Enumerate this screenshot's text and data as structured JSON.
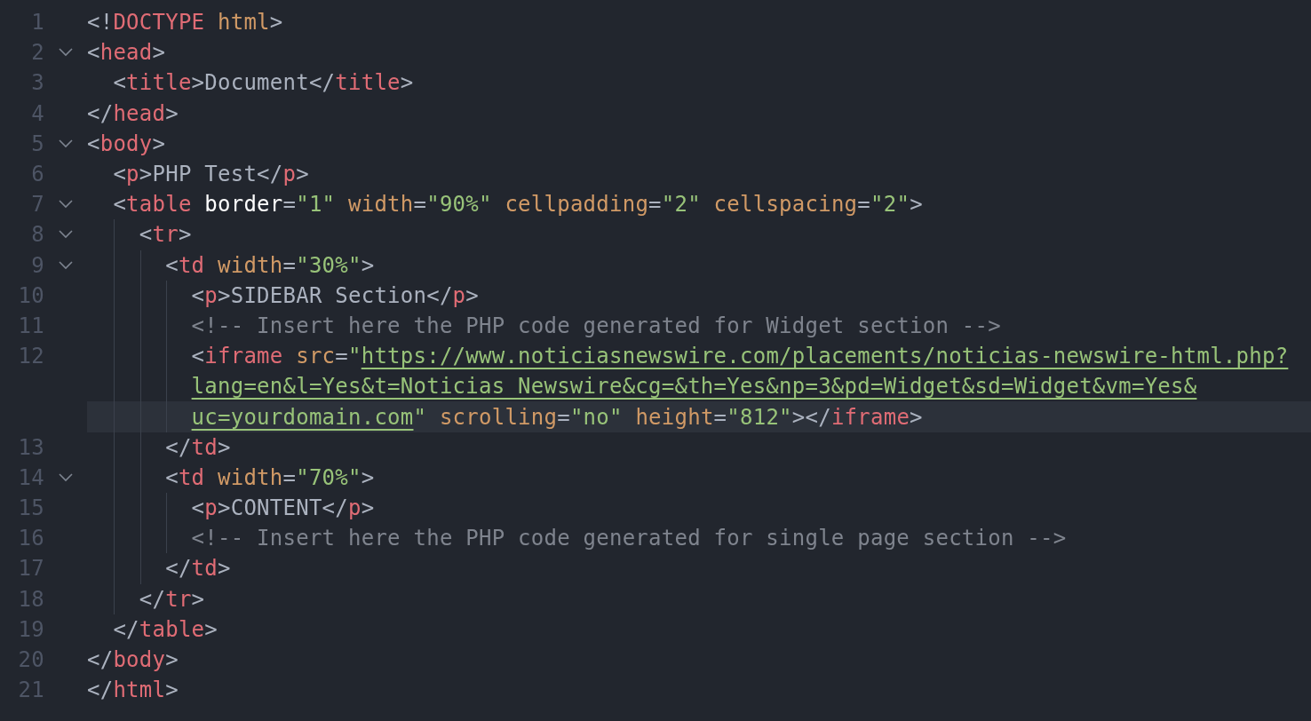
{
  "editor": {
    "lines": [
      {
        "number": "1",
        "rows": [
          {
            "highlighted": false,
            "tokens": [
              {
                "kind": "punct",
                "text": "<!"
              },
              {
                "kind": "tag",
                "text": "DOCTYPE"
              },
              {
                "kind": "attr",
                "text": " html"
              },
              {
                "kind": "punct",
                "text": ">"
              }
            ]
          }
        ]
      },
      {
        "number": "2",
        "expanded": true,
        "rows": [
          {
            "highlighted": false,
            "tokens": [
              {
                "kind": "punct",
                "text": "<"
              },
              {
                "kind": "tag",
                "text": "head"
              },
              {
                "kind": "punct",
                "text": ">"
              }
            ]
          }
        ],
        "children": [
          {
            "number": "3",
            "rows": [
              {
                "highlighted": false,
                "tokens": [
                  {
                    "kind": "punct",
                    "text": "<"
                  },
                  {
                    "kind": "tag",
                    "text": "title"
                  },
                  {
                    "kind": "punct",
                    "text": ">"
                  },
                  {
                    "kind": "text",
                    "text": "Document"
                  },
                  {
                    "kind": "punct",
                    "text": "</"
                  },
                  {
                    "kind": "tag",
                    "text": "title"
                  },
                  {
                    "kind": "punct",
                    "text": ">"
                  }
                ]
              }
            ]
          }
        ]
      },
      {
        "number": "4",
        "rows": [
          {
            "highlighted": false,
            "tokens": [
              {
                "kind": "punct",
                "text": "</"
              },
              {
                "kind": "tag",
                "text": "head"
              },
              {
                "kind": "punct",
                "text": ">"
              }
            ]
          }
        ]
      },
      {
        "number": "5",
        "expanded": true,
        "rows": [
          {
            "highlighted": false,
            "tokens": [
              {
                "kind": "punct",
                "text": "<"
              },
              {
                "kind": "tag",
                "text": "body"
              },
              {
                "kind": "punct",
                "text": ">"
              }
            ]
          }
        ],
        "children": [
          {
            "number": "6",
            "rows": [
              {
                "highlighted": false,
                "tokens": [
                  {
                    "kind": "punct",
                    "text": "<"
                  },
                  {
                    "kind": "tag",
                    "text": "p"
                  },
                  {
                    "kind": "punct",
                    "text": ">"
                  },
                  {
                    "kind": "text",
                    "text": "PHP Test"
                  },
                  {
                    "kind": "punct",
                    "text": "</"
                  },
                  {
                    "kind": "tag",
                    "text": "p"
                  },
                  {
                    "kind": "punct",
                    "text": ">"
                  }
                ]
              }
            ]
          },
          {
            "number": "7",
            "expanded": true,
            "rows": [
              {
                "highlighted": false,
                "tokens": [
                  {
                    "kind": "punct",
                    "text": "<"
                  },
                  {
                    "kind": "tag",
                    "text": "table"
                  },
                  {
                    "kind": "attr-strong",
                    "text": " border"
                  },
                  {
                    "kind": "punct",
                    "text": "="
                  },
                  {
                    "kind": "string",
                    "text": "\"1\""
                  },
                  {
                    "kind": "attr",
                    "text": " width"
                  },
                  {
                    "kind": "punct",
                    "text": "="
                  },
                  {
                    "kind": "string",
                    "text": "\"90%\""
                  },
                  {
                    "kind": "attr",
                    "text": " cellpadding"
                  },
                  {
                    "kind": "punct",
                    "text": "="
                  },
                  {
                    "kind": "string",
                    "text": "\"2\""
                  },
                  {
                    "kind": "attr",
                    "text": " cellspacing"
                  },
                  {
                    "kind": "punct",
                    "text": "="
                  },
                  {
                    "kind": "string",
                    "text": "\"2\""
                  },
                  {
                    "kind": "punct",
                    "text": ">"
                  }
                ]
              }
            ],
            "children": [
              {
                "number": "8",
                "expanded": true,
                "rows": [
                  {
                    "highlighted": false,
                    "tokens": [
                      {
                        "kind": "punct",
                        "text": "<"
                      },
                      {
                        "kind": "tag",
                        "text": "tr"
                      },
                      {
                        "kind": "punct",
                        "text": ">"
                      }
                    ]
                  }
                ],
                "children": [
                  {
                    "number": "9",
                    "expanded": true,
                    "rows": [
                      {
                        "highlighted": false,
                        "tokens": [
                          {
                            "kind": "punct",
                            "text": "<"
                          },
                          {
                            "kind": "tag",
                            "text": "td"
                          },
                          {
                            "kind": "attr",
                            "text": " width"
                          },
                          {
                            "kind": "punct",
                            "text": "="
                          },
                          {
                            "kind": "string",
                            "text": "\"30%\""
                          },
                          {
                            "kind": "punct",
                            "text": ">"
                          }
                        ]
                      }
                    ],
                    "children": [
                      {
                        "number": "10",
                        "rows": [
                          {
                            "highlighted": false,
                            "tokens": [
                              {
                                "kind": "punct",
                                "text": "<"
                              },
                              {
                                "kind": "tag",
                                "text": "p"
                              },
                              {
                                "kind": "punct",
                                "text": ">"
                              },
                              {
                                "kind": "text",
                                "text": "SIDEBAR Section"
                              },
                              {
                                "kind": "punct",
                                "text": "</"
                              },
                              {
                                "kind": "tag",
                                "text": "p"
                              },
                              {
                                "kind": "punct",
                                "text": ">"
                              }
                            ]
                          }
                        ]
                      },
                      {
                        "number": "11",
                        "rows": [
                          {
                            "highlighted": false,
                            "tokens": [
                              {
                                "kind": "comment",
                                "text": "<!-- Insert here the PHP code generated for Widget section -->"
                              }
                            ]
                          }
                        ]
                      },
                      {
                        "number": "12",
                        "rows": [
                          {
                            "highlighted": false,
                            "tokens": [
                              {
                                "kind": "punct",
                                "text": "<"
                              },
                              {
                                "kind": "tag",
                                "text": "iframe"
                              },
                              {
                                "kind": "attr",
                                "text": " src"
                              },
                              {
                                "kind": "punct",
                                "text": "="
                              },
                              {
                                "kind": "string",
                                "text": "\""
                              },
                              {
                                "kind": "link",
                                "text": "https://www.noticiasnewswire.com/placements/noticias-newswire-html.php?"
                              }
                            ]
                          },
                          {
                            "highlighted": false,
                            "tokens": [
                              {
                                "kind": "link",
                                "text": "lang=en&l=Yes&t=Noticias Newswire&cg=&th=Yes&np=3&pd=Widget&sd=Widget&vm=Yes&"
                              }
                            ]
                          },
                          {
                            "highlighted": true,
                            "tokens": [
                              {
                                "kind": "link",
                                "text": "uc=yourdomain.com"
                              },
                              {
                                "kind": "string",
                                "text": "\""
                              },
                              {
                                "kind": "attr",
                                "text": " scrolling"
                              },
                              {
                                "kind": "punct",
                                "text": "="
                              },
                              {
                                "kind": "string",
                                "text": "\"no\""
                              },
                              {
                                "kind": "attr",
                                "text": " height"
                              },
                              {
                                "kind": "punct",
                                "text": "="
                              },
                              {
                                "kind": "string",
                                "text": "\"812\""
                              },
                              {
                                "kind": "punct",
                                "text": "></"
                              },
                              {
                                "kind": "tag",
                                "text": "iframe"
                              },
                              {
                                "kind": "punct",
                                "text": ">"
                              }
                            ]
                          }
                        ]
                      }
                    ]
                  },
                  {
                    "number": "13",
                    "rows": [
                      {
                        "highlighted": false,
                        "tokens": [
                          {
                            "kind": "punct",
                            "text": "</"
                          },
                          {
                            "kind": "tag",
                            "text": "td"
                          },
                          {
                            "kind": "punct",
                            "text": ">"
                          }
                        ]
                      }
                    ]
                  },
                  {
                    "number": "14",
                    "expanded": true,
                    "rows": [
                      {
                        "highlighted": false,
                        "tokens": [
                          {
                            "kind": "punct",
                            "text": "<"
                          },
                          {
                            "kind": "tag",
                            "text": "td"
                          },
                          {
                            "kind": "attr",
                            "text": " width"
                          },
                          {
                            "kind": "punct",
                            "text": "="
                          },
                          {
                            "kind": "string",
                            "text": "\"70%\""
                          },
                          {
                            "kind": "punct",
                            "text": ">"
                          }
                        ]
                      }
                    ],
                    "children": [
                      {
                        "number": "15",
                        "rows": [
                          {
                            "highlighted": false,
                            "tokens": [
                              {
                                "kind": "punct",
                                "text": "<"
                              },
                              {
                                "kind": "tag",
                                "text": "p"
                              },
                              {
                                "kind": "punct",
                                "text": ">"
                              },
                              {
                                "kind": "text",
                                "text": "CONTENT"
                              },
                              {
                                "kind": "punct",
                                "text": "</"
                              },
                              {
                                "kind": "tag",
                                "text": "p"
                              },
                              {
                                "kind": "punct",
                                "text": ">"
                              }
                            ]
                          }
                        ]
                      },
                      {
                        "number": "16",
                        "rows": [
                          {
                            "highlighted": false,
                            "tokens": [
                              {
                                "kind": "comment",
                                "text": "<!-- Insert here the PHP code generated for single page section -->"
                              }
                            ]
                          }
                        ]
                      }
                    ]
                  },
                  {
                    "number": "17",
                    "rows": [
                      {
                        "highlighted": false,
                        "tokens": [
                          {
                            "kind": "punct",
                            "text": "</"
                          },
                          {
                            "kind": "tag",
                            "text": "td"
                          },
                          {
                            "kind": "punct",
                            "text": ">"
                          }
                        ]
                      }
                    ]
                  }
                ]
              },
              {
                "number": "18",
                "rows": [
                  {
                    "highlighted": false,
                    "tokens": [
                      {
                        "kind": "punct",
                        "text": "</"
                      },
                      {
                        "kind": "tag",
                        "text": "tr"
                      },
                      {
                        "kind": "punct",
                        "text": ">"
                      }
                    ]
                  }
                ]
              }
            ]
          },
          {
            "number": "19",
            "rows": [
              {
                "highlighted": false,
                "tokens": [
                  {
                    "kind": "punct",
                    "text": "</"
                  },
                  {
                    "kind": "tag",
                    "text": "table"
                  },
                  {
                    "kind": "punct",
                    "text": ">"
                  }
                ]
              }
            ]
          }
        ]
      },
      {
        "number": "20",
        "rows": [
          {
            "highlighted": false,
            "tokens": [
              {
                "kind": "punct",
                "text": "</"
              },
              {
                "kind": "tag",
                "text": "body"
              },
              {
                "kind": "punct",
                "text": ">"
              }
            ]
          }
        ]
      },
      {
        "number": "21",
        "rows": [
          {
            "highlighted": false,
            "tokens": [
              {
                "kind": "punct",
                "text": "</"
              },
              {
                "kind": "tag",
                "text": "html"
              },
              {
                "kind": "punct",
                "text": ">"
              }
            ]
          }
        ]
      }
    ]
  }
}
